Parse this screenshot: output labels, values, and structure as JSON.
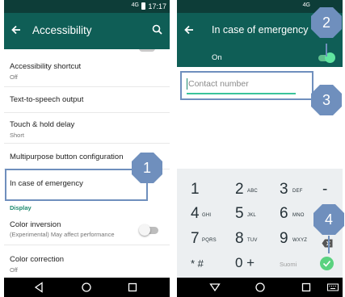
{
  "left_phone": {
    "status_time": "17:17",
    "status_signal": "4G",
    "app_title": "Accessibility",
    "items": [
      {
        "title": "Accessibility shortcut",
        "subtitle": "Off"
      },
      {
        "title": "Text-to-speech output",
        "subtitle": ""
      },
      {
        "title": "Touch & hold delay",
        "subtitle": "Short"
      },
      {
        "title": "Multipurpose button configuration",
        "subtitle": ""
      },
      {
        "title": "In case of emergency",
        "subtitle": ""
      }
    ],
    "section_display": "Display",
    "color_inversion": {
      "title": "Color inversion",
      "subtitle": "(Experimental) May affect performance",
      "state": "off"
    },
    "color_correction": {
      "title": "Color correction",
      "subtitle": "Off"
    }
  },
  "right_phone": {
    "status_signal": "4G",
    "app_title": "In case of emergency",
    "toggle_label": "On",
    "toggle_state": "on",
    "contact_placeholder": "Contact number",
    "keypad": {
      "rows": [
        [
          {
            "digit": "1",
            "letters": ""
          },
          {
            "digit": "2",
            "letters": "ABC"
          },
          {
            "digit": "3",
            "letters": "DEF"
          }
        ],
        [
          {
            "digit": "4",
            "letters": "GHI"
          },
          {
            "digit": "5",
            "letters": "JKL"
          },
          {
            "digit": "6",
            "letters": "MNO"
          }
        ],
        [
          {
            "digit": "7",
            "letters": "PQRS"
          },
          {
            "digit": "8",
            "letters": "TUV"
          },
          {
            "digit": "9",
            "letters": "WXYZ"
          }
        ]
      ],
      "minus": "-",
      "star_hash": "* #",
      "zero_plus": "0 +",
      "language": "Suomi"
    }
  },
  "callouts": {
    "one": "1",
    "two": "2",
    "three": "3",
    "four": "4"
  },
  "colors": {
    "toolbar": "#0f5e56",
    "statusbar": "#0d3d38",
    "accent": "#1f8a6f",
    "callout": "#6f8fbd",
    "toggle_on": "#61e5a0",
    "keypad_bg": "#eceff1"
  },
  "icons": [
    "back-arrow-icon",
    "search-icon",
    "nav-back-icon",
    "nav-home-icon",
    "nav-recents-icon",
    "keyboard-icon",
    "delete-icon",
    "done-check-icon",
    "battery-icon",
    "signal-icon"
  ]
}
